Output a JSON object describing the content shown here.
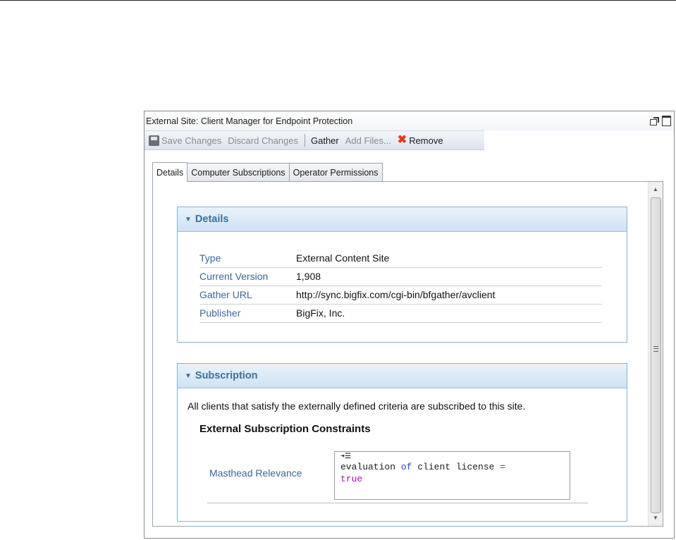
{
  "window": {
    "title": "External Site: Client Manager for Endpoint Protection",
    "title_icons": [
      "undock-icon",
      "maximize-icon"
    ]
  },
  "toolbar": {
    "save_changes": "Save Changes",
    "discard_changes": "Discard Changes",
    "gather": "Gather",
    "add_files": "Add Files...",
    "remove": "Remove"
  },
  "tabs": [
    {
      "label": "Details",
      "active": true
    },
    {
      "label": "Computer Subscriptions",
      "active": false
    },
    {
      "label": "Operator Permissions",
      "active": false
    }
  ],
  "details": {
    "heading": "Details",
    "rows": [
      {
        "label": "Type",
        "value": "External Content Site"
      },
      {
        "label": "Current Version",
        "value": "1,908"
      },
      {
        "label": "Gather URL",
        "value": "http://sync.bigfix.com/cgi-bin/bfgather/avclient"
      },
      {
        "label": "Publisher",
        "value": "BigFix, Inc."
      }
    ]
  },
  "subscription": {
    "heading": "Subscription",
    "text": "All clients that satisfy the externally defined criteria are subscribed to this site.",
    "constraints_heading": "External Subscription Constraints",
    "masthead_label": "Masthead Relevance",
    "relevance": {
      "line1_a": "evaluation ",
      "line1_kw": "of",
      "line1_b": " client license ",
      "line1_op": "=",
      "line2": "true"
    }
  },
  "colors": {
    "panel_border": "#7fb2da",
    "panel_heading": "#3f6f9a",
    "label_blue": "#3c6795",
    "remove_red": "#e03b22"
  }
}
